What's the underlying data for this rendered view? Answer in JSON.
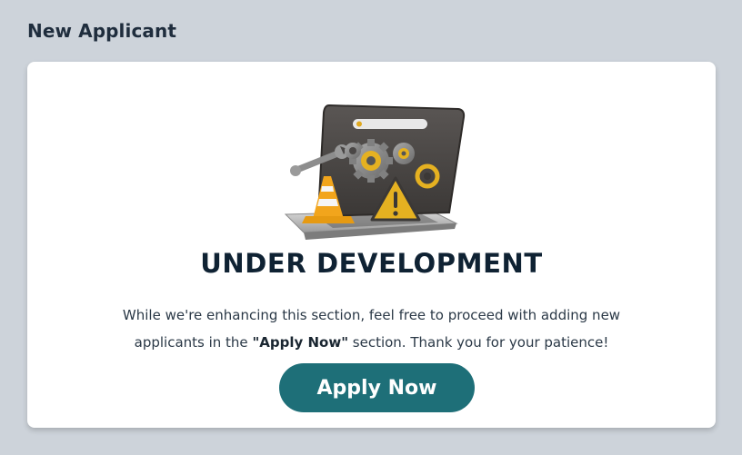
{
  "page": {
    "title": "New Applicant"
  },
  "notice": {
    "illustration_icon": "laptop-under-construction-icon",
    "heading": "UNDER DEVELOPMENT",
    "message_before": "While we're enhancing this section, feel free to proceed with adding new applicants in the ",
    "message_highlight": "\"Apply Now\"",
    "message_after": " section. Thank you for your patience!",
    "button_label": "Apply Now"
  },
  "colors": {
    "background": "#cdd3da",
    "card": "#ffffff",
    "button": "#1e6f78",
    "heading": "#0f2233"
  }
}
